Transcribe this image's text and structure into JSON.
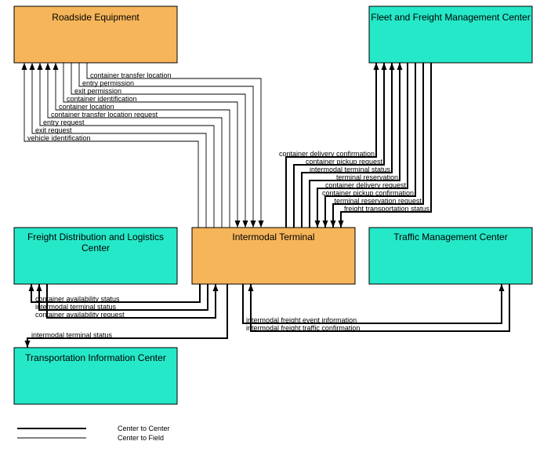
{
  "nodes": {
    "roadside": {
      "label": "Roadside Equipment"
    },
    "fleet": {
      "label": "Fleet and Freight Management Center"
    },
    "freight": {
      "label": "Freight Distribution and Logistics Center"
    },
    "intermodal": {
      "label": "Intermodal Terminal"
    },
    "traffic": {
      "label": "Traffic Management Center"
    },
    "transport": {
      "label": "Transportation Information Center"
    }
  },
  "flows": {
    "roadside_intermodal": {
      "to_intermodal": [
        "container transfer location",
        "entry permission",
        "exit permission",
        "container identification"
      ],
      "to_roadside": [
        "container location",
        "container transfer location request",
        "entry request",
        "exit request",
        "vehicle identification"
      ]
    },
    "fleet_intermodal": {
      "to_fleet": [
        "container delivery confirmation",
        "container pickup request",
        "intermodal terminal status",
        "terminal reservation"
      ],
      "to_intermodal": [
        "container delivery request",
        "container pickup confirmation",
        "terminal reservation request",
        "freight transportation status"
      ]
    },
    "freight_intermodal": {
      "to_freight": [
        "container availability status",
        "intermodal terminal status"
      ],
      "to_intermodal": [
        "container availability request"
      ]
    },
    "traffic_intermodal": {
      "to_traffic": [
        "intermodal freight event information"
      ],
      "to_intermodal": [
        "intermodal freight traffic confirmation"
      ]
    },
    "transport_intermodal": {
      "to_transport": [
        "intermodal terminal status"
      ]
    }
  },
  "legend": {
    "center": "Center to Center",
    "field": "Center to Field"
  },
  "chart_data": {
    "type": "diagram",
    "title": "",
    "nodes": [
      {
        "id": "roadside",
        "label": "Roadside Equipment",
        "kind": "field"
      },
      {
        "id": "fleet",
        "label": "Fleet and Freight Management Center",
        "kind": "center"
      },
      {
        "id": "freight",
        "label": "Freight Distribution and Logistics Center",
        "kind": "center"
      },
      {
        "id": "intermodal",
        "label": "Intermodal Terminal",
        "kind": "field"
      },
      {
        "id": "traffic",
        "label": "Traffic Management Center",
        "kind": "center"
      },
      {
        "id": "transport",
        "label": "Transportation Information Center",
        "kind": "center"
      }
    ],
    "edges": [
      {
        "from": "roadside",
        "to": "intermodal",
        "link": "field",
        "label": "container transfer location"
      },
      {
        "from": "roadside",
        "to": "intermodal",
        "link": "field",
        "label": "entry permission"
      },
      {
        "from": "roadside",
        "to": "intermodal",
        "link": "field",
        "label": "exit permission"
      },
      {
        "from": "roadside",
        "to": "intermodal",
        "link": "field",
        "label": "container identification"
      },
      {
        "from": "intermodal",
        "to": "roadside",
        "link": "field",
        "label": "container location"
      },
      {
        "from": "intermodal",
        "to": "roadside",
        "link": "field",
        "label": "container transfer location request"
      },
      {
        "from": "intermodal",
        "to": "roadside",
        "link": "field",
        "label": "entry request"
      },
      {
        "from": "intermodal",
        "to": "roadside",
        "link": "field",
        "label": "exit request"
      },
      {
        "from": "intermodal",
        "to": "roadside",
        "link": "field",
        "label": "vehicle identification"
      },
      {
        "from": "intermodal",
        "to": "fleet",
        "link": "center",
        "label": "container delivery confirmation"
      },
      {
        "from": "intermodal",
        "to": "fleet",
        "link": "center",
        "label": "container pickup request"
      },
      {
        "from": "intermodal",
        "to": "fleet",
        "link": "center",
        "label": "intermodal terminal status"
      },
      {
        "from": "intermodal",
        "to": "fleet",
        "link": "center",
        "label": "terminal reservation"
      },
      {
        "from": "fleet",
        "to": "intermodal",
        "link": "center",
        "label": "container delivery request"
      },
      {
        "from": "fleet",
        "to": "intermodal",
        "link": "center",
        "label": "container pickup confirmation"
      },
      {
        "from": "fleet",
        "to": "intermodal",
        "link": "center",
        "label": "terminal reservation request"
      },
      {
        "from": "fleet",
        "to": "intermodal",
        "link": "center",
        "label": "freight transportation status"
      },
      {
        "from": "intermodal",
        "to": "freight",
        "link": "center",
        "label": "container availability status"
      },
      {
        "from": "intermodal",
        "to": "freight",
        "link": "center",
        "label": "intermodal terminal status"
      },
      {
        "from": "freight",
        "to": "intermodal",
        "link": "center",
        "label": "container availability request"
      },
      {
        "from": "intermodal",
        "to": "traffic",
        "link": "center",
        "label": "intermodal freight event information"
      },
      {
        "from": "traffic",
        "to": "intermodal",
        "link": "center",
        "label": "intermodal freight traffic confirmation"
      },
      {
        "from": "intermodal",
        "to": "transport",
        "link": "center",
        "label": "intermodal terminal status"
      }
    ],
    "legend": [
      {
        "style": "center",
        "label": "Center to Center"
      },
      {
        "style": "field",
        "label": "Center to Field"
      }
    ]
  }
}
